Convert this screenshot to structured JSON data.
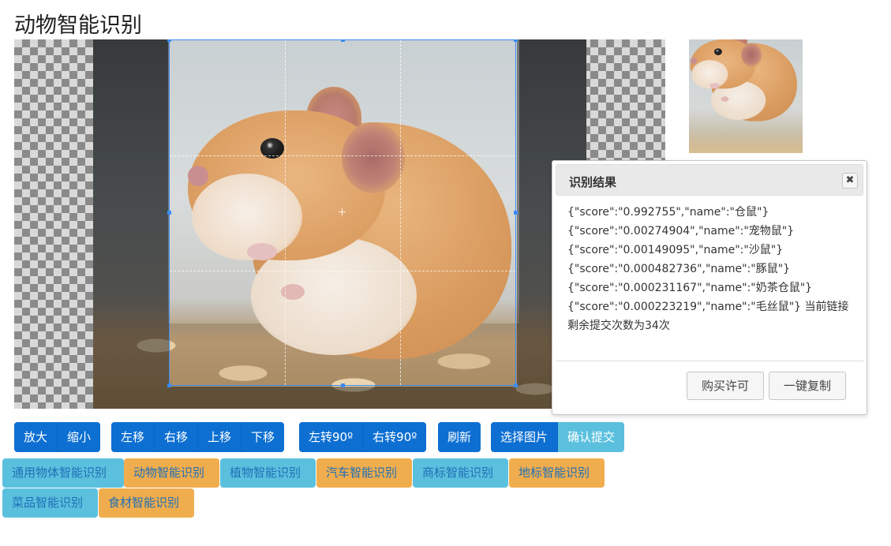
{
  "page": {
    "title": "动物智能识别"
  },
  "preview": {
    "label": ""
  },
  "dialog": {
    "title": "识别结果",
    "close_glyph": "✖",
    "results": [
      "{\"score\":\"0.992755\",\"name\":\"仓鼠\"}",
      "{\"score\":\"0.00274904\",\"name\":\"宠物鼠\"}",
      "{\"score\":\"0.00149095\",\"name\":\"沙鼠\"}",
      "{\"score\":\"0.000482736\",\"name\":\"豚鼠\"}",
      "{\"score\":\"0.000231167\",\"name\":\"奶茶仓鼠\"}",
      "{\"score\":\"0.000223219\",\"name\":\"毛丝鼠\"} 当前链接"
    ],
    "remaining": "剩余提交次数为34次",
    "buy_label": "购买许可",
    "copy_label": "一键复制"
  },
  "toolbar": {
    "zoom_in": "放大",
    "zoom_out": "缩小",
    "move_left": "左移",
    "move_right": "右移",
    "move_up": "上移",
    "move_down": "下移",
    "rotate_left": "左转90º",
    "rotate_right": "右转90º",
    "refresh": "刷新",
    "choose_image": "选择图片",
    "confirm_submit": "确认提交"
  },
  "modes": [
    {
      "label": "通用物体智能识别",
      "color": "#5bc0de"
    },
    {
      "label": "动物智能识别",
      "color": "#f0ad4e"
    },
    {
      "label": "植物智能识别",
      "color": "#5bc0de"
    },
    {
      "label": "汽车智能识别",
      "color": "#f0ad4e"
    },
    {
      "label": "商标智能识别",
      "color": "#5bc0de"
    },
    {
      "label": "地标智能识别",
      "color": "#f0ad4e"
    },
    {
      "label": "菜品智能识别",
      "color": "#5bc0de"
    },
    {
      "label": "食材智能识别",
      "color": "#f0ad4e"
    }
  ],
  "colors": {
    "primary": "#0d6fd2",
    "info": "#5bc0de",
    "warning": "#f0ad4e",
    "crop_border": "#3c8cf0"
  }
}
